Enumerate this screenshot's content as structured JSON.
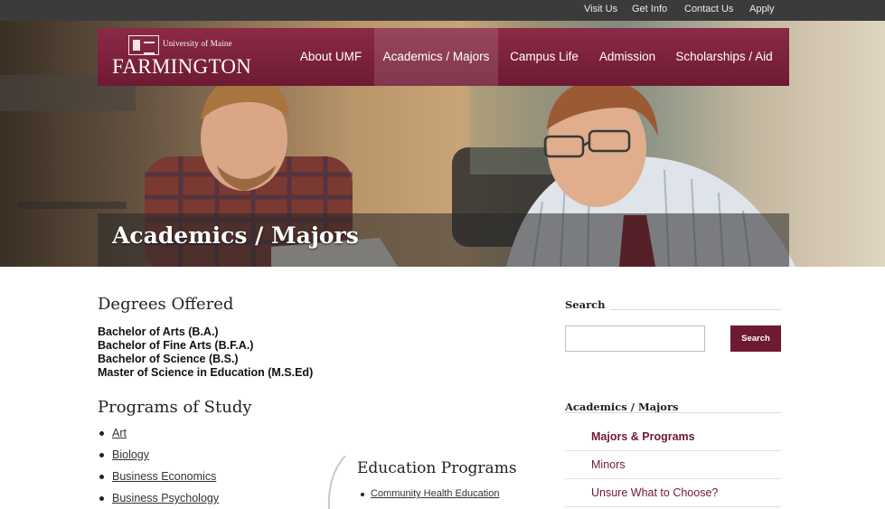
{
  "utility_nav": [
    "Visit Us",
    "Get Info",
    "Contact Us",
    "Apply"
  ],
  "logo": {
    "line1": "University of Maine",
    "line2": "FARMINGTON"
  },
  "main_nav": {
    "items": [
      "About UMF",
      "Academics / Majors",
      "Campus Life",
      "Admission",
      "Scholarships / Aid"
    ],
    "active": "Academics / Majors"
  },
  "hero": {
    "title": "Academics / Majors"
  },
  "degrees": {
    "heading": "Degrees Offered",
    "items": [
      "Bachelor of Arts (B.A.)",
      "Bachelor of Fine Arts (B.F.A.)",
      "Bachelor of Science (B.S.)",
      "Master of Science in Education (M.S.Ed)"
    ]
  },
  "programs": {
    "heading": "Programs of Study",
    "items": [
      "Art",
      "Biology",
      "Business Economics",
      "Business Psychology"
    ]
  },
  "education_programs": {
    "heading": "Education Programs",
    "items": [
      "Community Health Education"
    ]
  },
  "sidebar": {
    "search": {
      "heading": "Search",
      "placeholder": "",
      "value": "",
      "button_label": "Search"
    },
    "section": {
      "heading": "Academics / Majors",
      "items": [
        "Majors & Programs",
        "Minors",
        "Unsure What to Choose?"
      ],
      "current": "Majors & Programs"
    }
  },
  "colors": {
    "brand": "#6e1a33",
    "brand_light": "#8b2a46",
    "utility_bar": "#3b3b3b"
  },
  "icons": [
    "university-crest-icon"
  ]
}
